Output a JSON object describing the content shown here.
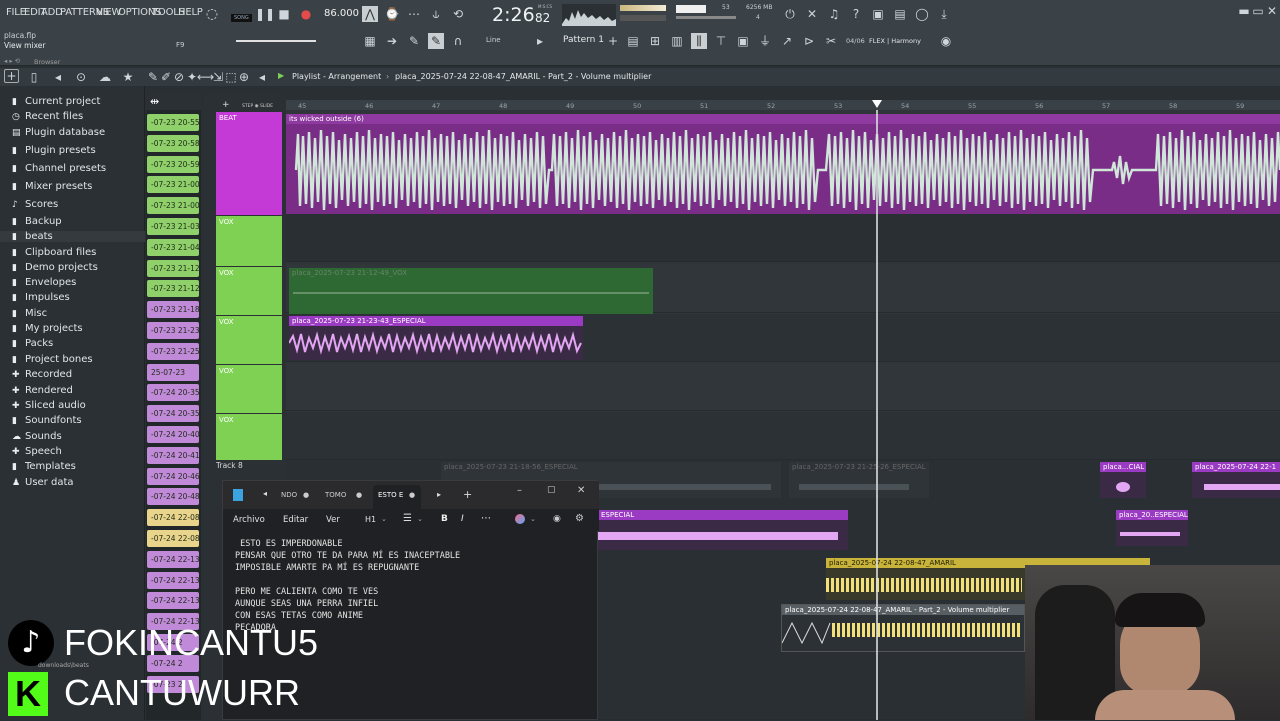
{
  "menu": [
    "FILE",
    "EDIT",
    "ADD",
    "PATTERNS",
    "VIEW",
    "OPTIONS",
    "TOOLS",
    "HELP"
  ],
  "transport": {
    "bpm": "86.000",
    "time": "2:26",
    "time_sub": "82",
    "msc": "M:S:CS",
    "song_label": "SONG",
    "memory": "6256 MB",
    "cpu": "53",
    "voices": "4"
  },
  "project": {
    "file": "placa.flp",
    "hint": "View mixer",
    "hint_key": "F9"
  },
  "toolbar": {
    "pattern": "Pattern 1",
    "snap": "Line",
    "plugin_info": "04/06",
    "plugin_name": "FLEX | Harmony"
  },
  "browser": {
    "title": "Browser",
    "items": [
      "Current project",
      "Recent files",
      "Plugin database",
      "Plugin presets",
      "Channel presets",
      "Mixer presets",
      "Scores",
      "Backup",
      "beats",
      "Clipboard files",
      "Demo projects",
      "Envelopes",
      "Impulses",
      "Misc",
      "My projects",
      "Packs",
      "Project bones",
      "Recorded",
      "Rendered",
      "Sliced audio",
      "Soundfonts",
      "Sounds",
      "Speech",
      "Templates",
      "User data"
    ]
  },
  "playlist": {
    "title": "Playlist - Arrangement",
    "path": "placa_2025-07-24 22-08-47_AMARIL - Part_2 - Volume multiplier"
  },
  "ruler": [
    "45",
    "46",
    "47",
    "48",
    "49",
    "50",
    "51",
    "52",
    "53",
    "54",
    "55",
    "56",
    "57",
    "58",
    "59"
  ],
  "clip_chips": [
    {
      "label": "-07-23 20-55",
      "color": "#8fd06a"
    },
    {
      "label": "-07-23 20-58",
      "color": "#8fd06a"
    },
    {
      "label": "-07-23 20-59",
      "color": "#8fd06a"
    },
    {
      "label": "-07-23 21-00",
      "color": "#8fd06a"
    },
    {
      "label": "-07-23 21-00",
      "color": "#8fd06a"
    },
    {
      "label": "-07-23 21-03",
      "color": "#8fd06a"
    },
    {
      "label": "-07-23 21-04",
      "color": "#8fd06a"
    },
    {
      "label": "-07-23 21-12",
      "color": "#8fd06a"
    },
    {
      "label": "-07-23 21-12",
      "color": "#8fd06a"
    },
    {
      "label": "-07-23 21-18",
      "color": "#c08ad8"
    },
    {
      "label": "-07-23 21-23",
      "color": "#c08ad8"
    },
    {
      "label": "-07-23 21-25",
      "color": "#c08ad8"
    },
    {
      "label": "25-07-23",
      "color": "#c08ad8"
    },
    {
      "label": "-07-24 20-35",
      "color": "#c08ad8"
    },
    {
      "label": "-07-24 20-35",
      "color": "#c08ad8"
    },
    {
      "label": "-07-24 20-40",
      "color": "#c08ad8"
    },
    {
      "label": "-07-24 20-41",
      "color": "#c08ad8"
    },
    {
      "label": "-07-24 20-46",
      "color": "#c08ad8"
    },
    {
      "label": "-07-24 20-48",
      "color": "#c08ad8"
    },
    {
      "label": "-07-24 22-08",
      "color": "#e8d48a"
    },
    {
      "label": "-07-24 22-08",
      "color": "#e8d48a"
    },
    {
      "label": "-07-24 22-13",
      "color": "#c08ad8"
    },
    {
      "label": "-07-24 22-13",
      "color": "#c08ad8"
    },
    {
      "label": "-07-24 22-13",
      "color": "#c08ad8"
    },
    {
      "label": "-07-24 22-13",
      "color": "#c08ad8"
    },
    {
      "label": "-07-24 2",
      "color": "#c08ad8"
    },
    {
      "label": "-07-24 2",
      "color": "#c08ad8"
    },
    {
      "label": "-07-23 2",
      "color": "#c08ad8"
    }
  ],
  "tracks": {
    "beat": "BEAT",
    "vox": "VOX",
    "track8": "Track 8"
  },
  "clips": {
    "beat": "its wicked outside (6)",
    "vox1": "placa_2025-07-23 21-12-49_VOX",
    "vox2": "placa_2025-07-23 21-23-43_ESPECIAL",
    "t8a": "placa_2025-07-23 21-18-56_ESPECIAL",
    "t8b": "placa_2025-07-23 21-25-26_ESPECIAL",
    "t8c": "placa...CIAL",
    "t8d": "placa_2025-07-24 22-1",
    "esp": "ESPECIAL",
    "esp2": "placa_20..ESPECIAL",
    "amaril": "placa_2025-07-24 22-08-47_AMARIL",
    "amaril2": "placa_2025-07-24 22-08-47_AMARIL - Part_2 - Volume multiplier"
  },
  "notepad": {
    "tabs": [
      "NDO",
      "TOMO",
      "ESTO E"
    ],
    "menu": [
      "Archivo",
      "Editar",
      "Ver"
    ],
    "heading": "H1",
    "lines": [
      " ESTO ES IMPERDONABLE",
      "PENSAR QUE OTRO TE DA PARA MÍ ES INACEPTABLE",
      "IMPOSIBLE AMARTE PA MÍ ES REPUGNANTE",
      "",
      "PERO ME CALIENTA COMO TE VES",
      "AUNQUE SEAS UNA PERRA INFIEL",
      "CON ESAS TETAS COMO ANIME",
      "PECADORA"
    ]
  },
  "overlay": {
    "tiktok": "FOKINCANTU5",
    "kick": "CANTUWURR",
    "folder": "downloads\\beats"
  },
  "colors": {
    "beat": "#c33ad6",
    "vox": "#7fd153",
    "purple_clip": "#9b3bc4",
    "yellow_clip": "#e6d24a"
  }
}
